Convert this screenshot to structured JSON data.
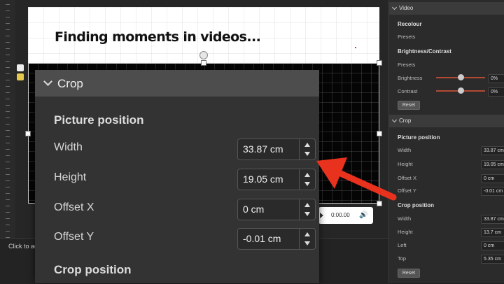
{
  "status_bar": {
    "text": "Click to ac"
  },
  "slide": {
    "title": "Finding moments in videos..."
  },
  "player": {
    "time": "0:00.00"
  },
  "zoom_panel": {
    "header": "Crop",
    "picture_position_title": "Picture position",
    "crop_position_title": "Crop position",
    "fields": [
      {
        "label": "Width",
        "value": "33.87 cm"
      },
      {
        "label": "Height",
        "value": "19.05 cm"
      },
      {
        "label": "Offset X",
        "value": "0 cm"
      },
      {
        "label": "Offset Y",
        "value": "-0.01 cm"
      }
    ]
  },
  "right_panel": {
    "video_header": "Video",
    "recolour_title": "Recolour",
    "presets_label": "Presets",
    "brightness_contrast_title": "Brightness/Contrast",
    "presets_label_2": "Presets",
    "brightness_label": "Brightness",
    "brightness_value": "0%",
    "contrast_label": "Contrast",
    "contrast_value": "0%",
    "reset_label": "Reset",
    "crop_header": "Crop",
    "picture_position_title": "Picture position",
    "picture_fields": [
      {
        "label": "Width",
        "value": "33.87 cm"
      },
      {
        "label": "Height",
        "value": "19.05 cm"
      },
      {
        "label": "Offset X",
        "value": "0 cm"
      },
      {
        "label": "Offset Y",
        "value": "-0.01 cm"
      }
    ],
    "crop_position_title": "Crop position",
    "crop_fields": [
      {
        "label": "Width",
        "value": "33.87 cm"
      },
      {
        "label": "Height",
        "value": "13.7 cm"
      },
      {
        "label": "Left",
        "value": "0 cm"
      },
      {
        "label": "Top",
        "value": "5.35 cm"
      }
    ],
    "reset_label_2": "Reset"
  },
  "annotation": {
    "arrow_color": "#e8321e"
  }
}
